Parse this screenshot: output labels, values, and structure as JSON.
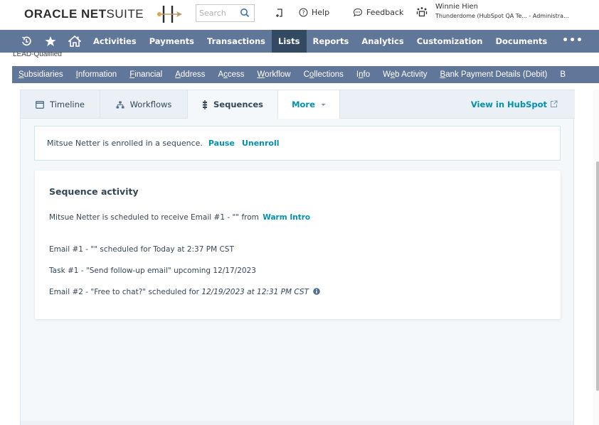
{
  "header": {
    "logo_bold": "ORACLE NET",
    "logo_light": "SUITE",
    "search_placeholder": "Search",
    "help_label": "Help",
    "feedback_label": "Feedback",
    "user_name": "Winnie Hien",
    "user_account": "Thunderdome (HubSpot QA Te...  - Administra..."
  },
  "main_nav": {
    "icons": [
      "recent-records-icon",
      "favorites-star-icon",
      "home-icon"
    ],
    "items": [
      {
        "label": "Activities",
        "active": false
      },
      {
        "label": "Payments",
        "active": false
      },
      {
        "label": "Transactions",
        "active": false
      },
      {
        "label": "Lists",
        "active": true
      },
      {
        "label": "Reports",
        "active": false
      },
      {
        "label": "Analytics",
        "active": false
      },
      {
        "label": "Customization",
        "active": false
      },
      {
        "label": "Documents",
        "active": false
      }
    ],
    "more_label": "•••"
  },
  "record": {
    "status": "LEAD-Qualified"
  },
  "subtabs": [
    {
      "label": "Subsidiaries",
      "accesskey": "S"
    },
    {
      "label": "Information",
      "accesskey": "I"
    },
    {
      "label": "Financial",
      "accesskey": "F"
    },
    {
      "label": "Address",
      "accesskey": "A"
    },
    {
      "label": "Access",
      "accesskey": "c"
    },
    {
      "label": "Workflow",
      "accesskey": "W"
    },
    {
      "label": "Collections",
      "accesskey": "o"
    },
    {
      "label": "Info",
      "accesskey": "n"
    },
    {
      "label": "Web Activity",
      "accesskey": "e"
    },
    {
      "label": "Bank Payment Details (Debit)",
      "accesskey": "B"
    },
    {
      "label": "B",
      "accesskey": ""
    }
  ],
  "hubspot": {
    "tabs": [
      {
        "label": "Timeline",
        "icon": "timeline-icon"
      },
      {
        "label": "Workflows",
        "icon": "workflows-icon"
      },
      {
        "label": "Sequences",
        "icon": "sequences-icon",
        "active": true
      },
      {
        "label": "More",
        "icon": "caret-down-icon"
      }
    ],
    "view_link": "View in HubSpot",
    "enrollment": {
      "message": "Mitsue Netter is enrolled in a sequence.",
      "pause_label": "Pause",
      "unenroll_label": "Unenroll"
    },
    "activity": {
      "title": "Sequence activity",
      "scheduled_prefix": "Mitsue Netter is scheduled to receive Email #1 - \"\" from",
      "sequence_name": "Warm Intro",
      "steps": [
        {
          "text": "Email #1 - \"\" scheduled for Today at 2:37 PM CST"
        },
        {
          "text": "Task #1 - \"Send follow-up email\" upcoming 12/17/2023"
        },
        {
          "text_prefix": "Email #2 - \"Free to chat?\" scheduled for",
          "text_italic": "12/19/2023 at 12:31 PM CST"
        }
      ]
    }
  },
  "colors": {
    "nav_bg": "#607799",
    "nav_active": "#344a62",
    "hubspot_link": "#0091ae",
    "hubspot_text": "#33475b",
    "panel_bg": "#f5f8fa"
  }
}
